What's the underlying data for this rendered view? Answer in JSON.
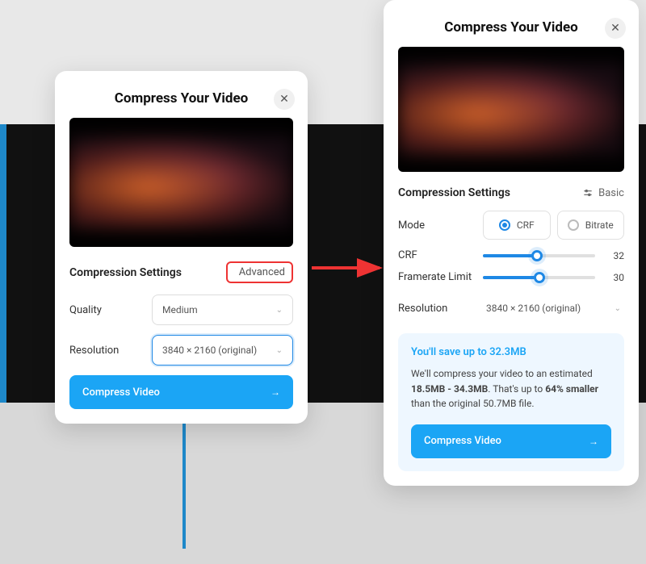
{
  "left_panel": {
    "title": "Compress Your Video",
    "section_title": "Compression Settings",
    "toggle_label": "Advanced",
    "quality_label": "Quality",
    "quality_value": "Medium",
    "resolution_label": "Resolution",
    "resolution_value": "3840 × 2160 (original)",
    "cta": "Compress Video"
  },
  "right_panel": {
    "title": "Compress Your Video",
    "section_title": "Compression Settings",
    "toggle_label": "Basic",
    "mode_label": "Mode",
    "mode_options": {
      "crf": "CRF",
      "bitrate": "Bitrate"
    },
    "crf_label": "CRF",
    "crf_value": "32",
    "framerate_label": "Framerate Limit",
    "framerate_value": "30",
    "resolution_label": "Resolution",
    "resolution_value": "3840 × 2160 (original)",
    "savings_title": "You'll save up to 32.3MB",
    "savings_body_1": "We'll compress your video to an estimated ",
    "savings_body_2": "18.5MB - 34.3MB",
    "savings_body_3": ". That's up to ",
    "savings_body_4": "64% smaller",
    "savings_body_5": " than the original 50.7MB file.",
    "cta": "Compress Video"
  },
  "sliders": {
    "crf_pct": 48,
    "framerate_pct": 50
  }
}
